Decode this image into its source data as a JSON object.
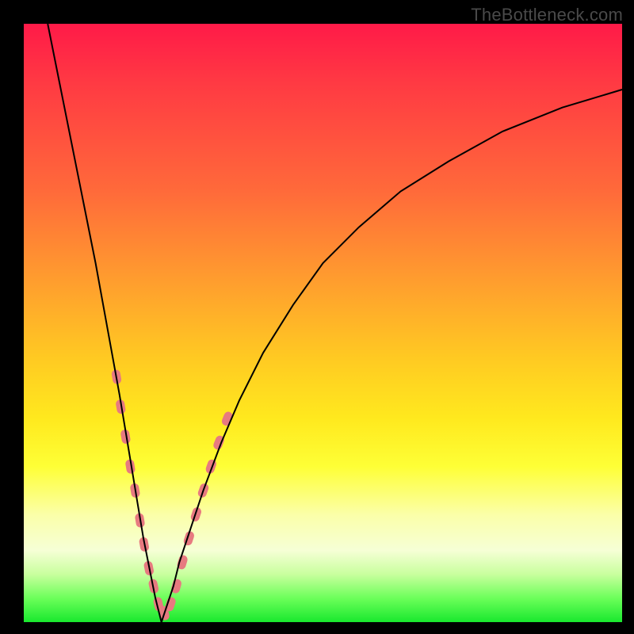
{
  "watermark": "TheBottleneck.com",
  "colors": {
    "frame": "#000000",
    "curve": "#000000",
    "bead": "#e77a80",
    "gradient_stops": [
      "#ff1a48",
      "#ff3a43",
      "#ff6a3a",
      "#ff9a2f",
      "#ffca22",
      "#ffe91e",
      "#feff36",
      "#fbffa8",
      "#f6ffd6",
      "#c9ff9e",
      "#6cff5a",
      "#19e82e"
    ]
  },
  "chart_data": {
    "type": "line",
    "title": "",
    "xlabel": "",
    "ylabel": "",
    "xlim": [
      0,
      100
    ],
    "ylim": [
      0,
      100
    ],
    "grid": false,
    "legend": false,
    "note": "Bottleneck-style V-curve. x is relative horizontal position (0–100). y is relative vertical position from bottom (0) to top (100). Vertex near x≈23, y≈0. Values estimated from pixel positions.",
    "series": [
      {
        "name": "left-branch",
        "x": [
          4,
          6,
          8,
          10,
          12,
          14,
          16,
          18,
          19,
          20,
          21,
          22,
          23
        ],
        "y": [
          100,
          90,
          80,
          70,
          60,
          49,
          38,
          26,
          20,
          14,
          9,
          4,
          0
        ]
      },
      {
        "name": "right-branch",
        "x": [
          23,
          24,
          25,
          26,
          28,
          30,
          33,
          36,
          40,
          45,
          50,
          56,
          63,
          71,
          80,
          90,
          100
        ],
        "y": [
          0,
          3,
          6,
          10,
          16,
          22,
          30,
          37,
          45,
          53,
          60,
          66,
          72,
          77,
          82,
          86,
          89
        ]
      }
    ],
    "markers": {
      "name": "beads",
      "note": "Coral capsule-like markers clustered along both branches near the vertex, roughly between y≈5 and y≈35.",
      "points": [
        {
          "x": 15.5,
          "y": 41
        },
        {
          "x": 16.2,
          "y": 36
        },
        {
          "x": 17.0,
          "y": 31
        },
        {
          "x": 17.8,
          "y": 26
        },
        {
          "x": 18.6,
          "y": 22
        },
        {
          "x": 19.4,
          "y": 17
        },
        {
          "x": 20.1,
          "y": 13
        },
        {
          "x": 20.9,
          "y": 9
        },
        {
          "x": 21.7,
          "y": 6
        },
        {
          "x": 22.5,
          "y": 3
        },
        {
          "x": 23.5,
          "y": 1.5
        },
        {
          "x": 24.5,
          "y": 3
        },
        {
          "x": 25.5,
          "y": 6
        },
        {
          "x": 26.5,
          "y": 10
        },
        {
          "x": 27.6,
          "y": 14
        },
        {
          "x": 28.8,
          "y": 18
        },
        {
          "x": 30.0,
          "y": 22
        },
        {
          "x": 31.3,
          "y": 26
        },
        {
          "x": 32.6,
          "y": 30
        },
        {
          "x": 34.0,
          "y": 34
        }
      ]
    }
  }
}
